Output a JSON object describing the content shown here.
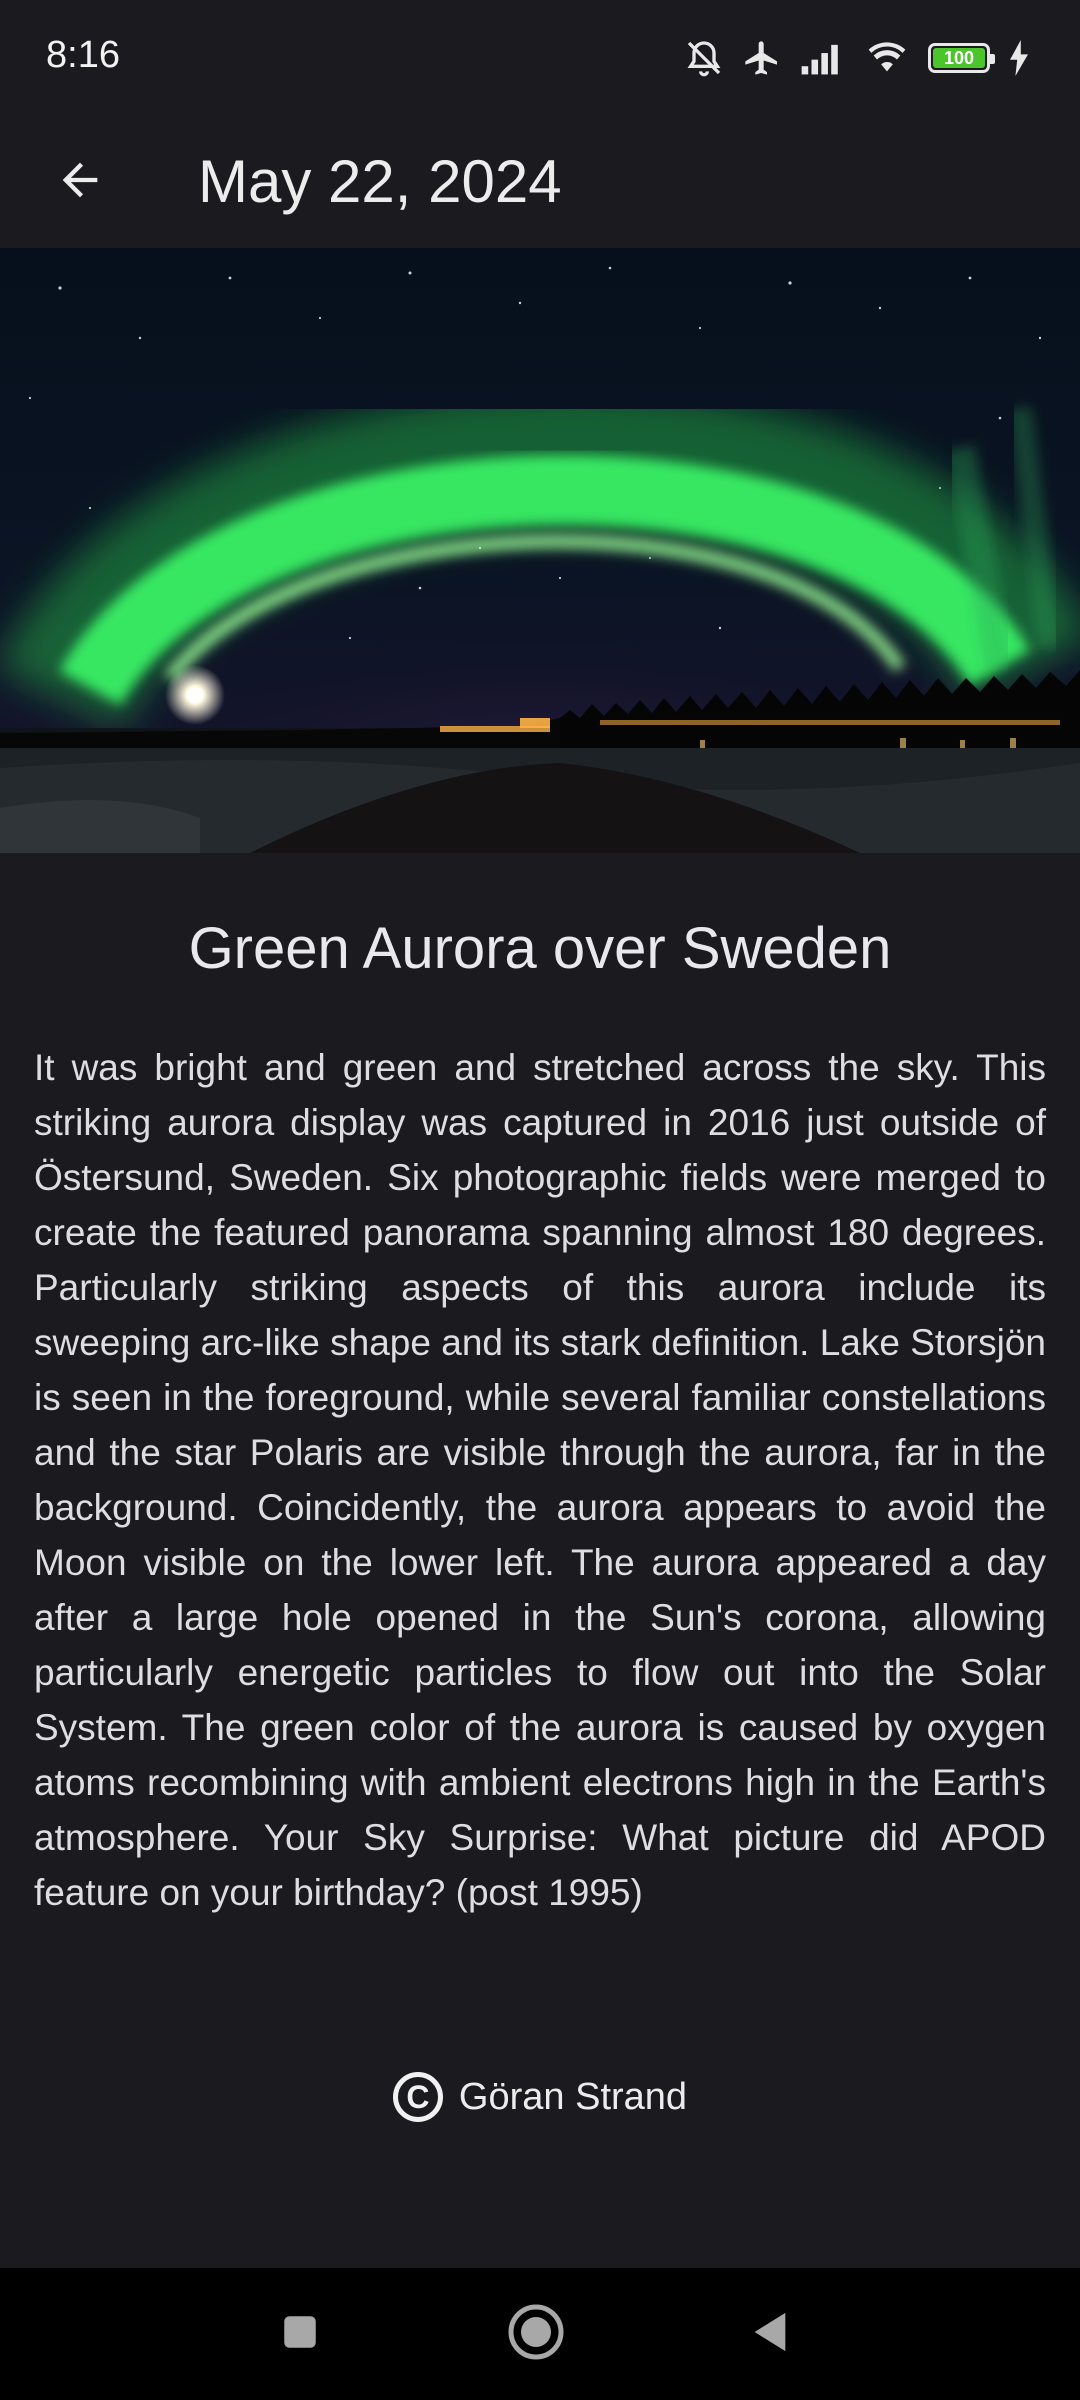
{
  "status_bar": {
    "time": "8:16",
    "battery_level": "100",
    "icons": [
      "mute-icon",
      "airplane-icon",
      "signal-icon",
      "wifi-icon",
      "battery-icon",
      "charging-icon"
    ]
  },
  "app_bar": {
    "title": "May 22, 2024",
    "back_icon": "arrow-back-icon"
  },
  "hero_image": {
    "description_name": "aurora-panorama-image"
  },
  "article": {
    "title": "Green Aurora over Sweden",
    "explanation": "It was bright and green and stretched across the sky. This striking aurora display was captured in 2016 just outside of Östersund, Sweden. Six photographic fields were merged to create the featured panorama spanning almost 180 degrees. Particularly striking aspects of this aurora include its sweeping arc-like shape and its stark definition. Lake Storsjön is seen in the foreground, while several familiar constellations and the star Polaris are visible through the aurora, far in the background. Coincidently, the aurora appears to avoid the Moon visible on the lower left. The aurora appeared a day after a large hole opened in the Sun's corona, allowing particularly energetic particles to flow out into the Solar System. The green color of the aurora is caused by oxygen atoms recombining with ambient electrons high in the Earth's atmosphere. Your Sky Surprise: What picture did APOD feature on your birthday? (post 1995)",
    "copyright_symbol": "C",
    "copyright": "Göran Strand"
  },
  "nav_bar": {
    "buttons": [
      "recents-button",
      "home-button",
      "back-button"
    ]
  },
  "colors": {
    "background": "#1b1b1f",
    "aurora_green": "#3cff6a",
    "battery_green": "#4cc42c"
  }
}
